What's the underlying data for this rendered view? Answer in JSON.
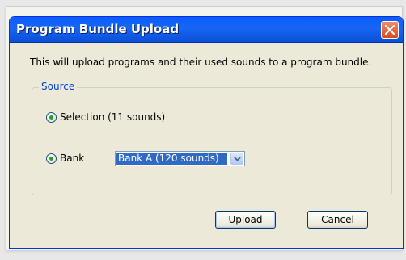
{
  "dialog": {
    "title": "Program Bundle Upload",
    "message": "This will upload programs and their used sounds to a program bundle."
  },
  "source": {
    "label": "Source",
    "option_selection": "Selection (11 sounds)",
    "option_bank": "Bank",
    "bank_selected": "Bank A (120 sounds)"
  },
  "buttons": {
    "upload": "Upload",
    "cancel": "Cancel"
  },
  "icons": {
    "close": "close-icon",
    "dropdown": "chevron-down-icon"
  },
  "colors": {
    "titlebar": "#0a5dfe",
    "close": "#d84a1d",
    "selection_highlight": "#316ac5",
    "group_label": "#0046d5"
  }
}
